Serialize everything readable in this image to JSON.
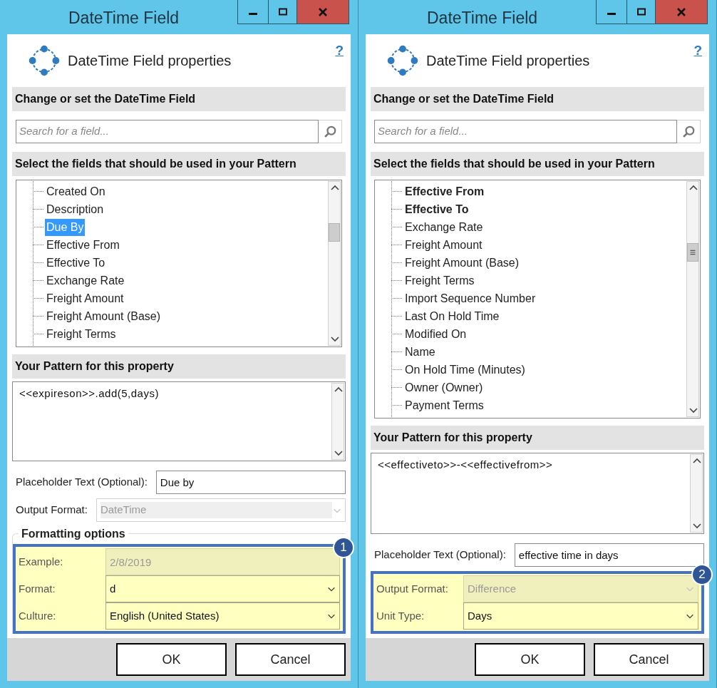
{
  "windows": [
    {
      "title": "DateTime Field",
      "heading": "DateTime Field properties",
      "help": "?",
      "search_section": "Change or set the DateTime Field",
      "search": {
        "placeholder": "Search for a field..."
      },
      "fields_section": "Select the fields that should be used in your Pattern",
      "fields": [
        {
          "label": "Created On",
          "selected": false,
          "bold": false
        },
        {
          "label": "Description",
          "selected": false,
          "bold": false
        },
        {
          "label": "Due By",
          "selected": true,
          "bold": false
        },
        {
          "label": "Effective From",
          "selected": false,
          "bold": false
        },
        {
          "label": "Effective To",
          "selected": false,
          "bold": false
        },
        {
          "label": "Exchange Rate",
          "selected": false,
          "bold": false
        },
        {
          "label": "Freight Amount",
          "selected": false,
          "bold": false
        },
        {
          "label": "Freight Amount (Base)",
          "selected": false,
          "bold": false
        },
        {
          "label": "Freight Terms",
          "selected": false,
          "bold": false
        }
      ],
      "pattern_section": "Your Pattern for this property",
      "pattern": "<<expireson>>.add(5,days)",
      "form": [
        {
          "kind": "text",
          "label": "Placeholder Text (Optional):",
          "value": "Due by",
          "disabled": false
        },
        {
          "kind": "select",
          "label": "Output Format:",
          "value": "DateTime",
          "disabled": true
        },
        {
          "kind": "group",
          "title": "Formatting options",
          "callout": "1",
          "rows": [
            {
              "kind": "text",
              "label": "Example:",
              "value": "2/8/2019",
              "disabled": true
            },
            {
              "kind": "select",
              "label": "Format:",
              "value": "d",
              "disabled": false
            },
            {
              "kind": "select",
              "label": "Culture:",
              "value": "English (United States)",
              "disabled": false
            }
          ]
        }
      ],
      "buttons": [
        "OK",
        "Cancel"
      ]
    },
    {
      "title": "DateTime Field",
      "heading": "DateTime Field properties",
      "help": "?",
      "search_section": "Change or set the DateTime Field",
      "search": {
        "placeholder": "Search for a field..."
      },
      "fields_section": "Select the fields that should be used in your Pattern",
      "fields": [
        {
          "label": "Effective From",
          "selected": false,
          "bold": true
        },
        {
          "label": "Effective To",
          "selected": false,
          "bold": true
        },
        {
          "label": "Exchange Rate",
          "selected": false,
          "bold": false
        },
        {
          "label": "Freight Amount",
          "selected": false,
          "bold": false
        },
        {
          "label": "Freight Amount (Base)",
          "selected": false,
          "bold": false
        },
        {
          "label": "Freight Terms",
          "selected": false,
          "bold": false
        },
        {
          "label": "Import Sequence Number",
          "selected": false,
          "bold": false
        },
        {
          "label": "Last On Hold Time",
          "selected": false,
          "bold": false
        },
        {
          "label": "Modified On",
          "selected": false,
          "bold": false
        },
        {
          "label": "Name",
          "selected": false,
          "bold": false
        },
        {
          "label": "On Hold Time (Minutes)",
          "selected": false,
          "bold": false
        },
        {
          "label": "Owner (Owner)",
          "selected": false,
          "bold": false
        },
        {
          "label": "Payment Terms",
          "selected": false,
          "bold": false
        }
      ],
      "pattern_section": "Your Pattern for this property",
      "pattern": "<<effectiveto>>-<<effectivefrom>>",
      "form": [
        {
          "kind": "text",
          "label": "Placeholder Text (Optional):",
          "value": "effective time in days",
          "disabled": false
        },
        {
          "kind": "callout",
          "callout": "2",
          "rows": [
            {
              "kind": "select",
              "label": "Output Format:",
              "value": "Difference",
              "disabled": true
            },
            {
              "kind": "select",
              "label": "Unit Type:",
              "value": "Days",
              "disabled": false
            }
          ]
        }
      ],
      "buttons": [
        "OK",
        "Cancel"
      ]
    }
  ]
}
